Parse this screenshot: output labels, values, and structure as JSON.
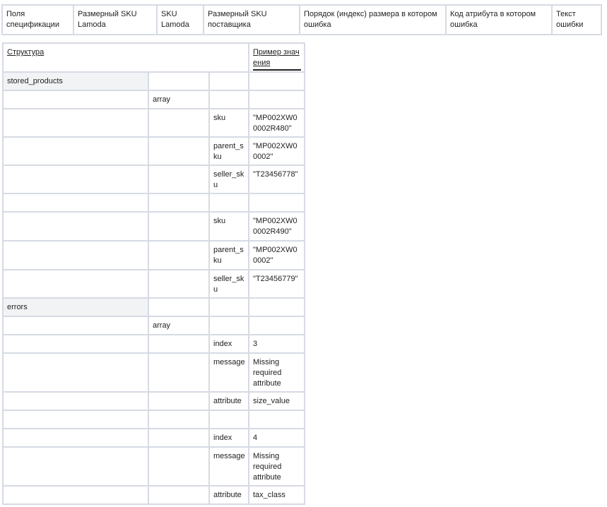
{
  "header_row": [
    "Поля спецификации",
    "Размерный SKU Lamoda",
    "SKU Lamoda",
    "Размерный SKU поставщика",
    "Порядок (индекс) размера в котором ошибка",
    "Код атрибута в котором ошибка",
    "Текст ошибки"
  ],
  "structure": {
    "col_structure": "Структура",
    "col_example": "Пример значения",
    "stored_products": {
      "label": "stored_products",
      "array": "array",
      "items": [
        {
          "sku": "sku",
          "sku_val": "\"MP002XW00002R480\"",
          "parent": "parent_sku",
          "parent_val": "\"MP002XW00002\"",
          "seller": "seller_sku",
          "seller_val": "\"T23456778\""
        },
        {
          "sku": "sku",
          "sku_val": "\"MP002XW00002R490\"",
          "parent": "parent_sku",
          "parent_val": "\"MP002XW00002\"",
          "seller": "seller_sku",
          "seller_val": "\"T23456779\""
        }
      ]
    },
    "errors": {
      "label": "errors",
      "array": "array",
      "items": [
        {
          "index": "index",
          "index_val": "3",
          "message": "message",
          "message_val": "Missing required attribute",
          "attribute": "attribute",
          "attribute_val": "size_value"
        },
        {
          "index": "index",
          "index_val": "4",
          "message": "message",
          "message_val": "Missing required attribute",
          "attribute": "attribute",
          "attribute_val": "tax_class"
        }
      ]
    }
  }
}
